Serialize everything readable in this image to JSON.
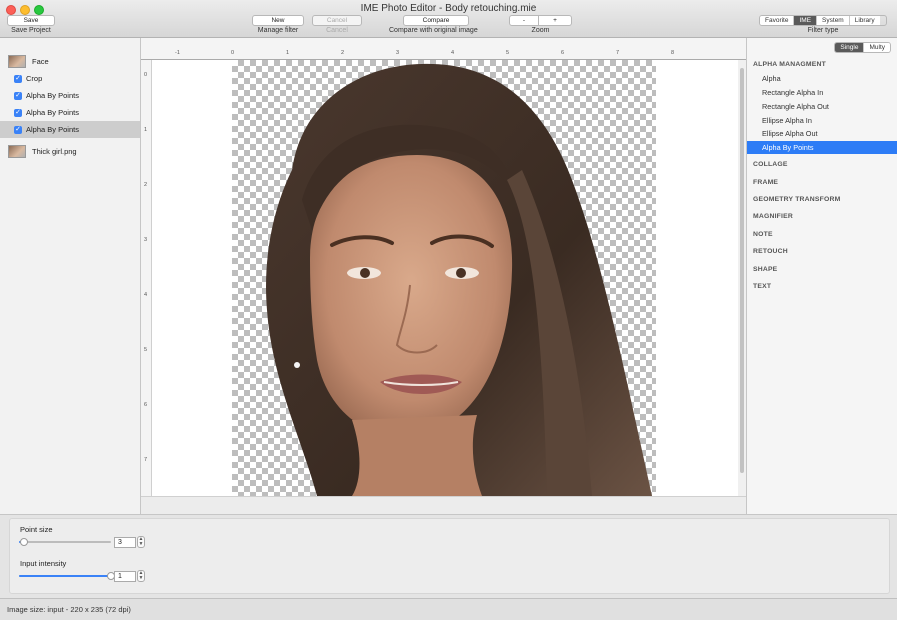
{
  "window": {
    "title": "IME Photo Editor - Body retouching.mie"
  },
  "toolbar": {
    "save_label": "Save",
    "save_caption": "Save Project",
    "new_label": "New",
    "manage_caption": "Manage filter",
    "cancel_label": "Cancel",
    "cancel_caption": "Cancel",
    "compare_label": "Compare",
    "compare_caption": "Compare with original image",
    "zoom_minus": "-",
    "zoom_plus": "+",
    "zoom_caption": "Zoom",
    "filter_tabs": [
      "Favorite",
      "IME",
      "System",
      "Library"
    ],
    "filter_caption": "Filter type"
  },
  "layers": [
    {
      "label": "Face",
      "type": "image"
    },
    {
      "label": "Crop",
      "type": "filter",
      "checked": true
    },
    {
      "label": "Alpha By Points",
      "type": "filter",
      "checked": true
    },
    {
      "label": "Alpha By Points",
      "type": "filter",
      "checked": true
    },
    {
      "label": "Alpha By Points",
      "type": "filter",
      "checked": true,
      "selected": true
    },
    {
      "label": "Thick girl.png",
      "type": "image"
    }
  ],
  "ruler": {
    "top": [
      "-1",
      "0",
      "1",
      "2",
      "3",
      "4",
      "5",
      "6",
      "7",
      "8"
    ],
    "left": [
      "0",
      "1",
      "2",
      "3",
      "4",
      "5",
      "6",
      "7"
    ]
  },
  "right_panel": {
    "mode": [
      "Single",
      "Multy"
    ],
    "categories": {
      "alpha": "ALPHA MANAGMENT",
      "alpha_items": [
        "Alpha",
        "Rectangle Alpha In",
        "Rectangle Alpha Out",
        "Ellipse Alpha In",
        "Ellipse Alpha Out",
        "Alpha By Points"
      ],
      "others": [
        "COLLAGE",
        "FRAME",
        "GEOMETRY TRANSFORM",
        "MAGNIFIER",
        "NOTE",
        "RETOUCH",
        "SHAPE",
        "TEXT"
      ]
    }
  },
  "params": {
    "point_size": {
      "label": "Point size",
      "value": "3",
      "fraction": 0.05
    },
    "input_intensity": {
      "label": "Input intensity",
      "value": "1",
      "fraction": 1.0
    }
  },
  "status": {
    "text": "Image size: input - 220 x 235 (72 dpi)"
  },
  "colors": {
    "accent": "#2d7cf6",
    "selection": "#cdcdcd"
  }
}
